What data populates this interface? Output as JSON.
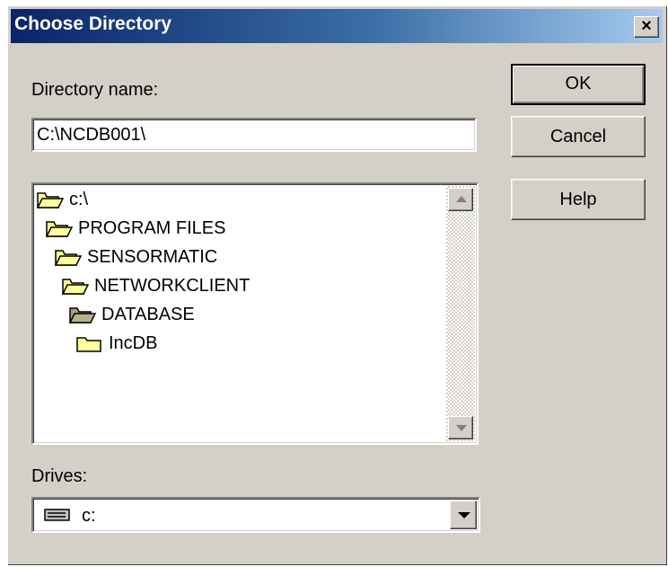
{
  "window": {
    "title": "Choose Directory",
    "close_glyph": "×"
  },
  "directory": {
    "label": "Directory name:",
    "value": "C:\\NCDB001\\"
  },
  "tree": {
    "items": [
      {
        "label": "c:\\",
        "icon": "open-folder-icon"
      },
      {
        "label": "PROGRAM FILES",
        "icon": "open-folder-icon"
      },
      {
        "label": "SENSORMATIC",
        "icon": "open-folder-icon"
      },
      {
        "label": "NETWORKCLIENT",
        "icon": "open-folder-icon"
      },
      {
        "label": "DATABASE",
        "icon": "open-folder-selected-icon"
      },
      {
        "label": "IncDB",
        "icon": "closed-folder-icon"
      }
    ]
  },
  "drives": {
    "label": "Drives:",
    "selected": "c:",
    "icon": "hard-drive-icon"
  },
  "buttons": {
    "ok": "OK",
    "cancel": "Cancel",
    "help": "Help"
  },
  "colors": {
    "dialog_bg": "#d4d0c8",
    "titlebar_start": "#0a246a",
    "titlebar_end": "#a6caf0",
    "folder_yellow": "#ffff99"
  }
}
